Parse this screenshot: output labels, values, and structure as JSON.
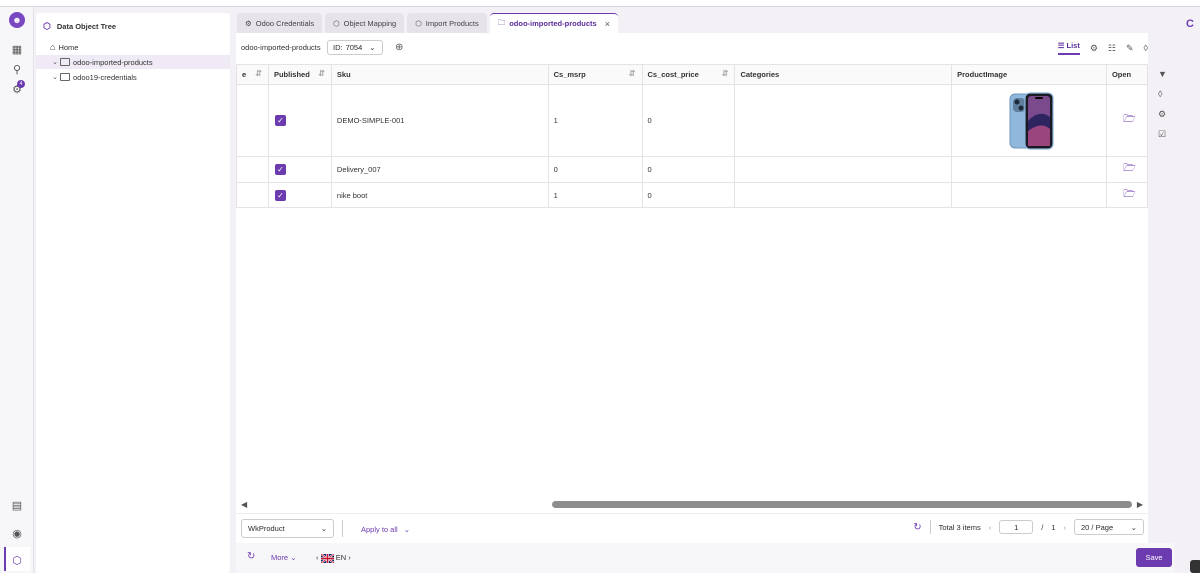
{
  "sidebar_tree": {
    "title": "Data Object Tree",
    "items": [
      {
        "label": "Home"
      },
      {
        "label": "odoo-imported-products"
      },
      {
        "label": "odoo19-credentials"
      }
    ]
  },
  "notification_count": "4",
  "tabs": [
    {
      "label": "Odoo Credentials"
    },
    {
      "label": "Object Mapping"
    },
    {
      "label": "Import Products"
    },
    {
      "label": "odoo-imported-products"
    }
  ],
  "toolbar": {
    "path": "odoo-imported-products",
    "id_label": "ID:",
    "id_value": "7054",
    "list_label": "List"
  },
  "table": {
    "columns": [
      "e",
      "Published",
      "Sku",
      "Cs_msrp",
      "Cs_cost_price",
      "Categories",
      "ProductImage",
      "Open"
    ],
    "rows": [
      {
        "published": true,
        "sku": "DEMO-SIMPLE-001",
        "cs_msrp": "1",
        "cs_cost_price": "0",
        "categories": "",
        "has_image": true
      },
      {
        "published": true,
        "sku": "Delivery_007",
        "cs_msrp": "0",
        "cs_cost_price": "0",
        "categories": "",
        "has_image": false
      },
      {
        "published": true,
        "sku": "nike boot",
        "cs_msrp": "1",
        "cs_cost_price": "0",
        "categories": "",
        "has_image": false
      }
    ]
  },
  "bottombar": {
    "class_select": "WkProduct",
    "apply_label": "Apply to all",
    "total": "Total 3 items",
    "page": "1",
    "page_sep": "/",
    "page_count": "1",
    "per_page": "20 / Page"
  },
  "footer": {
    "more_label": "More",
    "language": "EN",
    "save_label": "Save"
  },
  "colors": {
    "accent": "#6c3bb0"
  }
}
